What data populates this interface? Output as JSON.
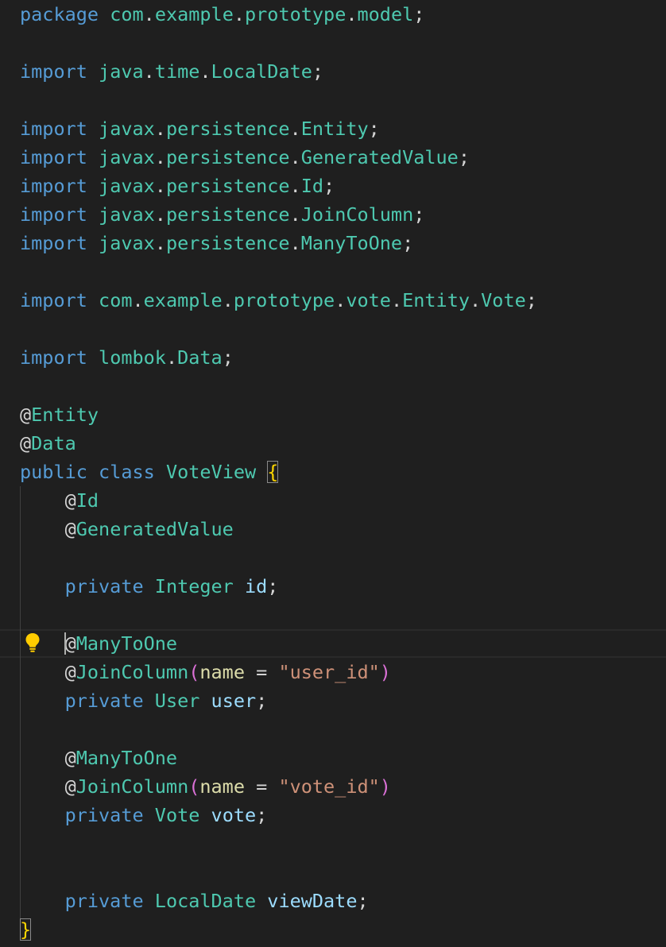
{
  "editor": {
    "language": "java",
    "lightbulb_icon": "lightbulb-icon",
    "colors": {
      "background": "#1f1f1f",
      "keyword": "#569cd6",
      "type": "#4ec9b0",
      "variable": "#9cdcfe",
      "parameter": "#dcdcaa",
      "string": "#ce9178",
      "bracket": "#ffd700",
      "paren": "#da70d6",
      "lightbulb": "#ffcc00"
    },
    "lines": [
      [
        {
          "t": "package",
          "c": "kw"
        },
        {
          "t": " ",
          "c": "punct"
        },
        {
          "t": "com",
          "c": "ns"
        },
        {
          "t": ".",
          "c": "punct"
        },
        {
          "t": "example",
          "c": "ns"
        },
        {
          "t": ".",
          "c": "punct"
        },
        {
          "t": "prototype",
          "c": "ns"
        },
        {
          "t": ".",
          "c": "punct"
        },
        {
          "t": "model",
          "c": "ns"
        },
        {
          "t": ";",
          "c": "punct"
        }
      ],
      [],
      [
        {
          "t": "import",
          "c": "kw"
        },
        {
          "t": " ",
          "c": "punct"
        },
        {
          "t": "java",
          "c": "ns"
        },
        {
          "t": ".",
          "c": "punct"
        },
        {
          "t": "time",
          "c": "ns"
        },
        {
          "t": ".",
          "c": "punct"
        },
        {
          "t": "LocalDate",
          "c": "type"
        },
        {
          "t": ";",
          "c": "punct"
        }
      ],
      [],
      [
        {
          "t": "import",
          "c": "kw"
        },
        {
          "t": " ",
          "c": "punct"
        },
        {
          "t": "javax",
          "c": "ns"
        },
        {
          "t": ".",
          "c": "punct"
        },
        {
          "t": "persistence",
          "c": "ns"
        },
        {
          "t": ".",
          "c": "punct"
        },
        {
          "t": "Entity",
          "c": "type"
        },
        {
          "t": ";",
          "c": "punct"
        }
      ],
      [
        {
          "t": "import",
          "c": "kw"
        },
        {
          "t": " ",
          "c": "punct"
        },
        {
          "t": "javax",
          "c": "ns"
        },
        {
          "t": ".",
          "c": "punct"
        },
        {
          "t": "persistence",
          "c": "ns"
        },
        {
          "t": ".",
          "c": "punct"
        },
        {
          "t": "GeneratedValue",
          "c": "type"
        },
        {
          "t": ";",
          "c": "punct"
        }
      ],
      [
        {
          "t": "import",
          "c": "kw"
        },
        {
          "t": " ",
          "c": "punct"
        },
        {
          "t": "javax",
          "c": "ns"
        },
        {
          "t": ".",
          "c": "punct"
        },
        {
          "t": "persistence",
          "c": "ns"
        },
        {
          "t": ".",
          "c": "punct"
        },
        {
          "t": "Id",
          "c": "type"
        },
        {
          "t": ";",
          "c": "punct"
        }
      ],
      [
        {
          "t": "import",
          "c": "kw"
        },
        {
          "t": " ",
          "c": "punct"
        },
        {
          "t": "javax",
          "c": "ns"
        },
        {
          "t": ".",
          "c": "punct"
        },
        {
          "t": "persistence",
          "c": "ns"
        },
        {
          "t": ".",
          "c": "punct"
        },
        {
          "t": "JoinColumn",
          "c": "type"
        },
        {
          "t": ";",
          "c": "punct"
        }
      ],
      [
        {
          "t": "import",
          "c": "kw"
        },
        {
          "t": " ",
          "c": "punct"
        },
        {
          "t": "javax",
          "c": "ns"
        },
        {
          "t": ".",
          "c": "punct"
        },
        {
          "t": "persistence",
          "c": "ns"
        },
        {
          "t": ".",
          "c": "punct"
        },
        {
          "t": "ManyToOne",
          "c": "type"
        },
        {
          "t": ";",
          "c": "punct"
        }
      ],
      [],
      [
        {
          "t": "import",
          "c": "kw"
        },
        {
          "t": " ",
          "c": "punct"
        },
        {
          "t": "com",
          "c": "ns"
        },
        {
          "t": ".",
          "c": "punct"
        },
        {
          "t": "example",
          "c": "ns"
        },
        {
          "t": ".",
          "c": "punct"
        },
        {
          "t": "prototype",
          "c": "ns"
        },
        {
          "t": ".",
          "c": "punct"
        },
        {
          "t": "vote",
          "c": "ns"
        },
        {
          "t": ".",
          "c": "punct"
        },
        {
          "t": "Entity",
          "c": "ns"
        },
        {
          "t": ".",
          "c": "punct"
        },
        {
          "t": "Vote",
          "c": "type"
        },
        {
          "t": ";",
          "c": "punct"
        }
      ],
      [],
      [
        {
          "t": "import",
          "c": "kw"
        },
        {
          "t": " ",
          "c": "punct"
        },
        {
          "t": "lombok",
          "c": "ns"
        },
        {
          "t": ".",
          "c": "punct"
        },
        {
          "t": "Data",
          "c": "type"
        },
        {
          "t": ";",
          "c": "punct"
        }
      ],
      [],
      [
        {
          "t": "@",
          "c": "punct"
        },
        {
          "t": "Entity",
          "c": "type"
        }
      ],
      [
        {
          "t": "@",
          "c": "punct"
        },
        {
          "t": "Data",
          "c": "type"
        }
      ],
      [
        {
          "t": "public",
          "c": "kw"
        },
        {
          "t": " ",
          "c": "punct"
        },
        {
          "t": "class",
          "c": "kw"
        },
        {
          "t": " ",
          "c": "punct"
        },
        {
          "t": "VoteView",
          "c": "type"
        },
        {
          "t": " ",
          "c": "punct"
        },
        {
          "t": "{",
          "c": "brace-box"
        }
      ],
      [
        {
          "t": "    ",
          "c": "punct"
        },
        {
          "t": "@",
          "c": "punct"
        },
        {
          "t": "Id",
          "c": "type"
        }
      ],
      [
        {
          "t": "    ",
          "c": "punct"
        },
        {
          "t": "@",
          "c": "punct"
        },
        {
          "t": "GeneratedValue",
          "c": "type"
        }
      ],
      [],
      [
        {
          "t": "    ",
          "c": "punct"
        },
        {
          "t": "private",
          "c": "kw"
        },
        {
          "t": " ",
          "c": "punct"
        },
        {
          "t": "Integer",
          "c": "type"
        },
        {
          "t": " ",
          "c": "punct"
        },
        {
          "t": "id",
          "c": "var"
        },
        {
          "t": ";",
          "c": "punct"
        }
      ],
      [],
      [
        {
          "t": "    ",
          "c": "punct"
        },
        {
          "t": "@",
          "c": "punct"
        },
        {
          "t": "ManyToOne",
          "c": "type"
        }
      ],
      [
        {
          "t": "    ",
          "c": "punct"
        },
        {
          "t": "@",
          "c": "punct"
        },
        {
          "t": "JoinColumn",
          "c": "type"
        },
        {
          "t": "(",
          "c": "paren"
        },
        {
          "t": "name",
          "c": "param"
        },
        {
          "t": " = ",
          "c": "punct"
        },
        {
          "t": "\"user_id\"",
          "c": "str"
        },
        {
          "t": ")",
          "c": "paren"
        }
      ],
      [
        {
          "t": "    ",
          "c": "punct"
        },
        {
          "t": "private",
          "c": "kw"
        },
        {
          "t": " ",
          "c": "punct"
        },
        {
          "t": "User",
          "c": "type"
        },
        {
          "t": " ",
          "c": "punct"
        },
        {
          "t": "user",
          "c": "var"
        },
        {
          "t": ";",
          "c": "punct"
        }
      ],
      [],
      [
        {
          "t": "    ",
          "c": "punct"
        },
        {
          "t": "@",
          "c": "punct"
        },
        {
          "t": "ManyToOne",
          "c": "type"
        }
      ],
      [
        {
          "t": "    ",
          "c": "punct"
        },
        {
          "t": "@",
          "c": "punct"
        },
        {
          "t": "JoinColumn",
          "c": "type"
        },
        {
          "t": "(",
          "c": "paren"
        },
        {
          "t": "name",
          "c": "param"
        },
        {
          "t": " = ",
          "c": "punct"
        },
        {
          "t": "\"vote_id\"",
          "c": "str"
        },
        {
          "t": ")",
          "c": "paren"
        }
      ],
      [
        {
          "t": "    ",
          "c": "punct"
        },
        {
          "t": "private",
          "c": "kw"
        },
        {
          "t": " ",
          "c": "punct"
        },
        {
          "t": "Vote",
          "c": "type"
        },
        {
          "t": " ",
          "c": "punct"
        },
        {
          "t": "vote",
          "c": "var"
        },
        {
          "t": ";",
          "c": "punct"
        }
      ],
      [],
      [],
      [
        {
          "t": "    ",
          "c": "punct"
        },
        {
          "t": "private",
          "c": "kw"
        },
        {
          "t": " ",
          "c": "punct"
        },
        {
          "t": "LocalDate",
          "c": "type"
        },
        {
          "t": " ",
          "c": "punct"
        },
        {
          "t": "viewDate",
          "c": "var"
        },
        {
          "t": ";",
          "c": "punct"
        }
      ],
      [
        {
          "t": "}",
          "c": "brace-box"
        }
      ]
    ]
  }
}
